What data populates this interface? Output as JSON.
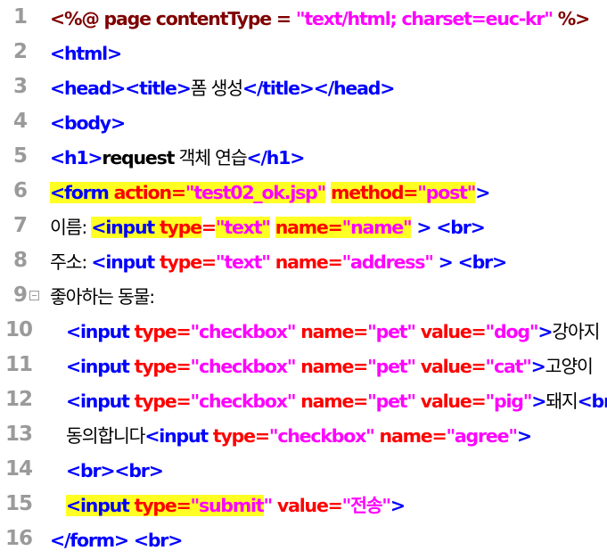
{
  "lines": [
    {
      "n": "1"
    },
    {
      "n": "2"
    },
    {
      "n": "3"
    },
    {
      "n": "4"
    },
    {
      "n": "5"
    },
    {
      "n": "6"
    },
    {
      "n": "7"
    },
    {
      "n": "8"
    },
    {
      "n": "9"
    },
    {
      "n": "10"
    },
    {
      "n": "11"
    },
    {
      "n": "12"
    },
    {
      "n": "13"
    },
    {
      "n": "14"
    },
    {
      "n": "15"
    },
    {
      "n": "16"
    }
  ],
  "code": {
    "l1": {
      "a": "<%@ page contentType = ",
      "b": "\"text/html; charset=euc-kr\"",
      "c": " %>"
    },
    "l2": {
      "a": "<html>"
    },
    "l3": {
      "a": "<head><title>",
      "b": "폼 생성",
      "c": "</title></head>"
    },
    "l4": {
      "a": "<body>"
    },
    "l5": {
      "a": "<h1>",
      "b": "request",
      "c": " 객체 연습",
      "d": "</h1>"
    },
    "l6": {
      "a": "<form",
      "b": " action=",
      "c": "\"test02_ok.jsp\"",
      "d": " ",
      "e": "method=",
      "f": "\"post\"",
      "g": ">"
    },
    "l7": {
      "a": "이름: ",
      "b": "<input",
      "c": " type",
      "d": "=",
      "e": "\"text\"",
      "f": " ",
      "g": "name=",
      "h": "\"name\"",
      "i": " > ",
      "j": "<br>"
    },
    "l8": {
      "a": "주소: ",
      "b": "<input",
      "c": " type=",
      "d": "\"text\"",
      "e": " name=",
      "f": "\"address\"",
      "g": " > ",
      "h": "<br>"
    },
    "l9": {
      "a": "좋아하는 동물:"
    },
    "l10": {
      "a": "<input",
      "b": " type=",
      "c": "\"checkbox\"",
      "d": " name=",
      "e": "\"pet\"",
      "f": " value=",
      "g": "\"dog\"",
      "h": ">",
      "i": "강아지"
    },
    "l11": {
      "a": "<input",
      "b": " type=",
      "c": "\"checkbox\"",
      "d": " name=",
      "e": "\"pet\"",
      "f": " value=",
      "g": "\"cat\"",
      "h": ">",
      "i": "고양이"
    },
    "l12": {
      "a": "<input",
      "b": " type=",
      "c": "\"checkbox\"",
      "d": " name=",
      "e": "\"pet\"",
      "f": " value=",
      "g": "\"pig\"",
      "h": ">",
      "i": "돼지",
      "j": "<br>"
    },
    "l13": {
      "a": "동의합니다",
      "b": "<input",
      "c": " type=",
      "d": "\"checkbox\"",
      "e": " name=",
      "f": "\"agree\"",
      "g": ">"
    },
    "l14": {
      "a": "<br><br>"
    },
    "l15": {
      "a": "<input",
      "b": " type",
      "c": "=",
      "d": "\"submit",
      "e": "\"",
      "f": " value=",
      "g": "\"전송\"",
      "h": ">"
    },
    "l16": {
      "a": "</form>",
      "b": " <br>"
    }
  },
  "colors": {
    "directive": "#7f0000",
    "tag": "#0000ff",
    "attribute": "#ff0000",
    "value": "#ff00ff",
    "text": "#000000",
    "highlight": "#ffff24",
    "line_number": "#9a9a9a"
  }
}
